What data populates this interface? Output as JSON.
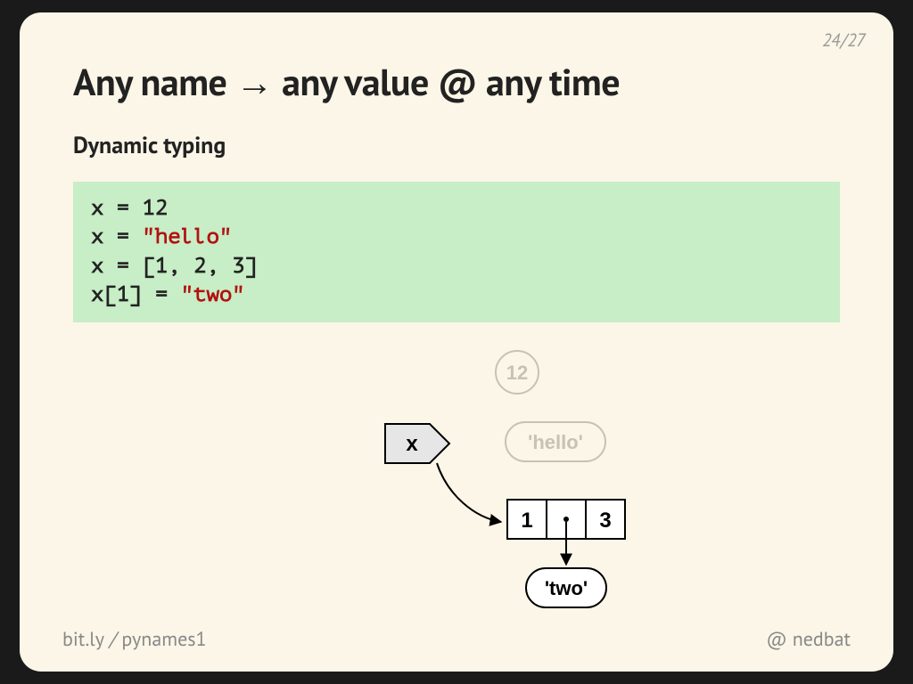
{
  "pager": {
    "current": "24",
    "sep": "/",
    "total": "27"
  },
  "title": "Any name → any value @ any time",
  "subtitle": "Dynamic typing",
  "code": {
    "l1a": "x = ",
    "l1b": "12",
    "l2a": "x = ",
    "l2b": "\"hello\"",
    "l3a": "x = [",
    "l3b": "1",
    "l3c": ", ",
    "l3d": "2",
    "l3e": ", ",
    "l3f": "3",
    "l3g": "]",
    "l4a": "x[",
    "l4b": "1",
    "l4c": "] = ",
    "l4d": "\"two\""
  },
  "diagram": {
    "name_label": "x",
    "val_12": "12",
    "val_hello": "'hello'",
    "list_0": "1",
    "list_2": "3",
    "val_two": "'two'"
  },
  "footer": {
    "short_domain": "bit.ly",
    "sep": "/",
    "short_path": "pynames1",
    "at": "@",
    "handle": "nedbat"
  }
}
